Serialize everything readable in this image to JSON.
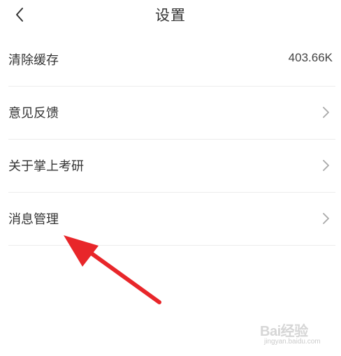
{
  "header": {
    "title": "设置",
    "back_icon": "chevron-left-icon"
  },
  "settings": {
    "items": [
      {
        "label": "清除缓存",
        "value": "403.66K"
      },
      {
        "label": "意见反馈",
        "icon": "chevron-right-icon"
      },
      {
        "label": "关于掌上考研",
        "icon": "chevron-right-icon"
      },
      {
        "label": "消息管理",
        "icon": "chevron-right-icon"
      }
    ]
  },
  "annotation": {
    "arrow_color": "#e8262a"
  },
  "watermark": {
    "brand": "Bai经验",
    "sub": "jingyan.baidu.com"
  }
}
